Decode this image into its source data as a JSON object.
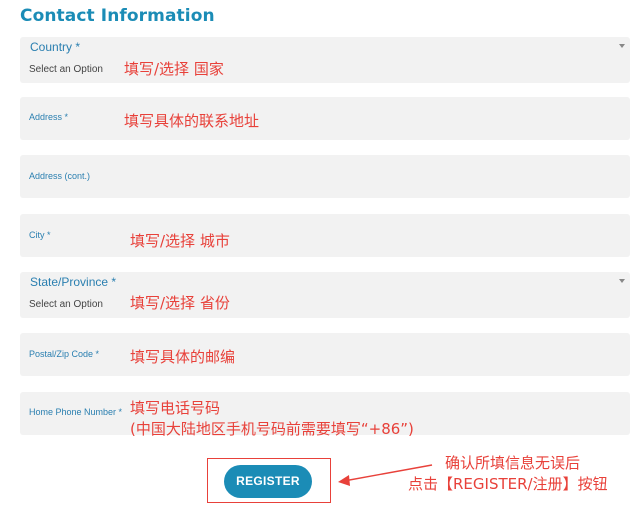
{
  "heading": "Contact Information",
  "fields": {
    "country": {
      "label": "Country *",
      "value": "Select an Option",
      "note": "填写/选择 国家"
    },
    "address": {
      "label": "Address *",
      "note": "填写具体的联系地址"
    },
    "address2": {
      "label": "Address (cont.)"
    },
    "city": {
      "label": "City *",
      "note": "填写/选择 城市"
    },
    "state": {
      "label": "State/Province *",
      "value": "Select an Option",
      "note": "填写/选择 省份"
    },
    "postal": {
      "label": "Postal/Zip Code *",
      "note": "填写具体的邮编"
    },
    "phone": {
      "label": "Home Phone Number *",
      "note_line1": "填写电话号码",
      "note_line2": "(中国大陆地区手机号码前需要填写“+86”)"
    }
  },
  "register": {
    "label": "REGISTER",
    "note_line1": "确认所填信息无误后",
    "note_line2": "点击【REGISTER/注册】按钮"
  },
  "colors": {
    "accent": "#1b8cb6",
    "annotation": "#e8413a",
    "field_bg": "#f2f2f2"
  }
}
